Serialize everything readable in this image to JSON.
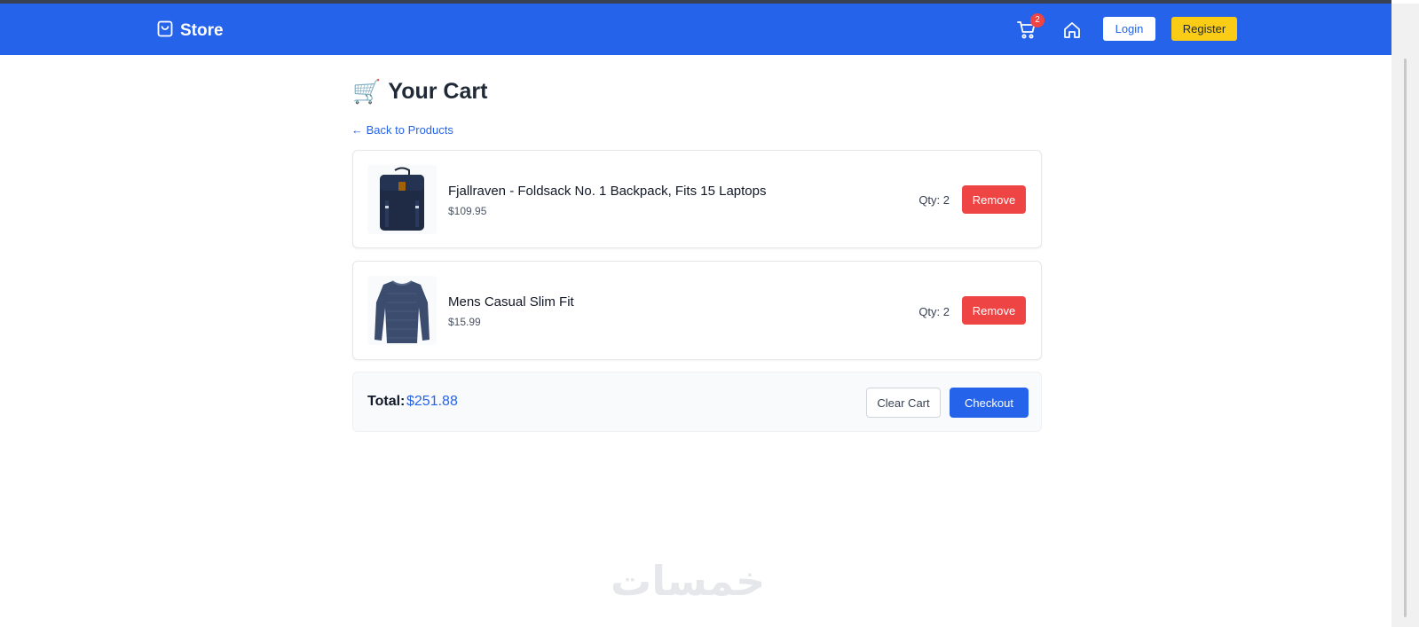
{
  "header": {
    "brand": "Store",
    "cart_count": "2",
    "login_label": "Login",
    "register_label": "Register"
  },
  "page": {
    "title": "Your Cart",
    "title_emoji": "🛒",
    "back_link": "← Back to Products"
  },
  "cart": {
    "items": [
      {
        "name": "Fjallraven - Foldsack No. 1 Backpack, Fits 15 Laptops",
        "price": "$109.95",
        "qty": "Qty: 2",
        "remove_label": "Remove",
        "image_icon": "backpack-image"
      },
      {
        "name": "Mens Casual Slim Fit",
        "price": "$15.99",
        "qty": "Qty: 2",
        "remove_label": "Remove",
        "image_icon": "shirt-image"
      }
    ],
    "total_label": "Total:",
    "total_value": "$251.88",
    "clear_label": "Clear Cart",
    "checkout_label": "Checkout"
  },
  "watermark": "خمسات",
  "colors": {
    "primary": "#2563eb",
    "danger": "#ef4444",
    "warning": "#facc15"
  }
}
